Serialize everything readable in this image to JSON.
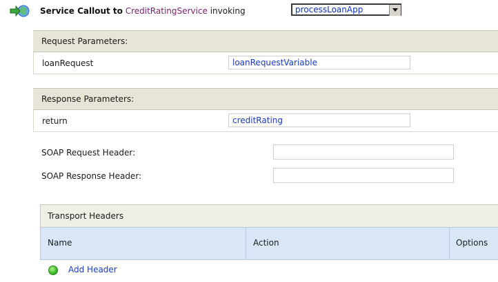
{
  "header": {
    "icon": "service-callout-icon",
    "title_prefix": "Service Callout to",
    "service_name": "CreditRatingService",
    "invoking_label": "invoking",
    "operation_selected": "processLoanApp"
  },
  "request": {
    "section_title": "Request Parameters:",
    "param_name": "loanRequest",
    "param_value": "loanRequestVariable"
  },
  "response": {
    "section_title": "Response Parameters:",
    "param_name": "return",
    "param_value": "creditRating"
  },
  "soap": {
    "request_header_label": "SOAP Request Header:",
    "request_header_value": "",
    "response_header_label": "SOAP Response Header:",
    "response_header_value": ""
  },
  "transport": {
    "title": "Transport Headers",
    "columns": [
      "Name",
      "Action",
      "Options"
    ],
    "add_label": "Add Header"
  },
  "colors": {
    "service_link": "#7a1f73",
    "value_link": "#1a3bc0",
    "section_bg": "#e7e5d8",
    "column_header_bg": "#d8e6f6"
  }
}
